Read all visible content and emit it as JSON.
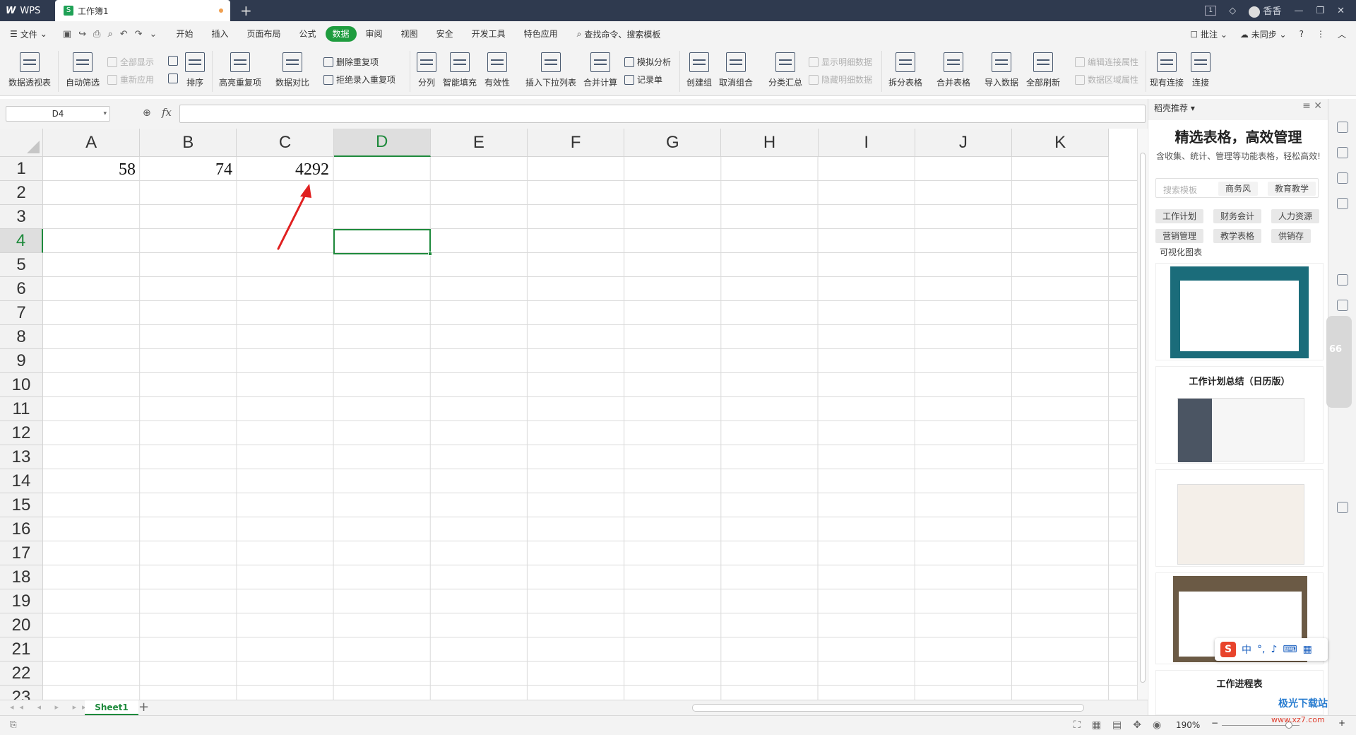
{
  "titlebar": {
    "app_tab": "WPS",
    "doc_tab": "工作簿1",
    "new_tab": "+",
    "user": "香香",
    "badge": "1"
  },
  "menubar": {
    "file": "文件",
    "tabs": [
      "开始",
      "插入",
      "页面布局",
      "公式",
      "数据",
      "审阅",
      "视图",
      "安全",
      "开发工具",
      "特色应用"
    ],
    "active_tab": "数据",
    "search": "查找命令、搜索模板",
    "right": [
      "批注",
      "未同步"
    ]
  },
  "ribbon": {
    "pivot": "数据透视表",
    "autofilter": "自动筛选",
    "show_all": "全部显示",
    "reapply": "重新应用",
    "sort": "排序",
    "highlight_dup": "高亮重复项",
    "compare": "数据对比",
    "delete_dup": "删除重复项",
    "reject_dup": "拒绝录入重复项",
    "split": "分列",
    "smart_fill": "智能填充",
    "validity": "有效性",
    "dropdown": "插入下拉列表",
    "consolidate": "合并计算",
    "whatif": "模拟分析",
    "record": "记录单",
    "create_group": "创建组",
    "ungroup": "取消组合",
    "subtotal": "分类汇总",
    "show_detail": "显示明细数据",
    "hide_detail": "隐藏明细数据",
    "split_table": "拆分表格",
    "merge_table": "合并表格",
    "import": "导入数据",
    "refresh_all": "全部刷新",
    "edit_link": "编辑连接属性",
    "data_area": "数据区域属性",
    "existing_conn": "现有连接",
    "connect": "连接"
  },
  "formula": {
    "namebox": "D4",
    "fx": "fx",
    "value": ""
  },
  "grid": {
    "columns": [
      "A",
      "B",
      "C",
      "D",
      "E",
      "F",
      "G",
      "H",
      "I",
      "J",
      "K"
    ],
    "selected_column": "D",
    "rows": [
      "1",
      "2",
      "3",
      "4",
      "5",
      "6",
      "7",
      "8",
      "9",
      "10",
      "11",
      "12",
      "13",
      "14",
      "15",
      "16",
      "17",
      "18",
      "19",
      "20",
      "21",
      "22",
      "23"
    ],
    "selected_row": "4",
    "cells": {
      "A1": "58",
      "B1": "74",
      "C1": "4292"
    },
    "active_cell": "D4"
  },
  "sheets": {
    "tabs": [
      "Sheet1"
    ],
    "add": "+"
  },
  "status": {
    "zoom": "190%"
  },
  "panel": {
    "header": "稻壳推荐",
    "title": "精选表格，高效管理",
    "subtitle": "含收集、统计、管理等功能表格，轻松高效!",
    "search_placeholder": "搜索模板",
    "search_tags": [
      "商务风",
      "教育教学"
    ],
    "categories": [
      "工作计划",
      "财务会计",
      "人力资源",
      "营销管理",
      "教学表格",
      "供销存"
    ],
    "visual_chart": "可视化图表",
    "templates": [
      "工作计划总结（日历版）",
      "工作进程表"
    ]
  },
  "toolstrip": {
    "net_percent": "66"
  },
  "ime": {
    "lang": "中"
  },
  "watermark": "极光下载站",
  "watermark_url": "www.xz7.com",
  "colors": {
    "accent": "#1e9c3e",
    "titlebar": "#2f3a4f",
    "arrow": "#e02020"
  }
}
